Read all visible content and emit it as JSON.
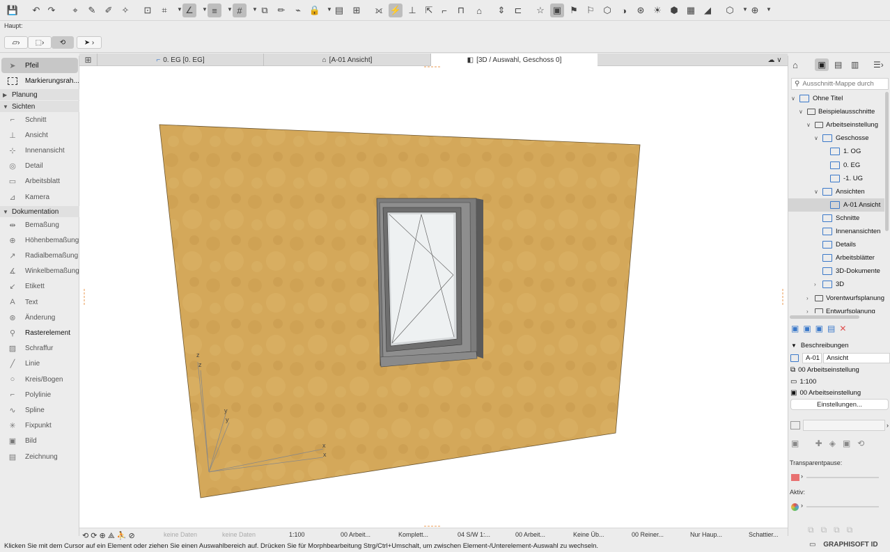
{
  "toolbar": {
    "icons": [
      "save-icon",
      "undo-icon",
      "redo-icon",
      "find-select-icon",
      "eyedropper-icon",
      "syringe-icon",
      "magic-wand-icon",
      "suspend-groups-icon",
      "gravity-icon",
      "snap-guides-icon",
      "guide-lines-icon",
      "grid-icon",
      "layers-icon",
      "pen-icon",
      "trace-icon",
      "lock-icon",
      "table-icon",
      "selection-grid-icon",
      "trim-icon",
      "split-icon",
      "adjust-icon",
      "offset-icon",
      "fillet-icon",
      "intersect-icon",
      "roof-icon",
      "elevate-icon",
      "resize-icon",
      "favorites-icon",
      "marquee-icon",
      "flag-icon",
      "flag2-icon",
      "shell-icon",
      "morph-icon",
      "object-icon",
      "lamp-icon",
      "zone-icon",
      "mesh-icon",
      "label-tag-icon",
      "view-3d-icon",
      "globe-icon"
    ]
  },
  "info": {
    "haupt_label": "Haupt:"
  },
  "toolbox": {
    "arrow": "Pfeil",
    "marquee": "Markierungsrah...",
    "group_planung": "Planung",
    "group_sichten": "Sichten",
    "sichten_tools": [
      "Schnitt",
      "Ansicht",
      "Innenansicht",
      "Detail",
      "Arbeitsblatt",
      "Kamera"
    ],
    "group_doku": "Dokumentation",
    "doku_tools": [
      "Bemaßung",
      "Höhenbemaßung",
      "Radialbemaßung",
      "Winkelbemaßung",
      "Etikett",
      "Text",
      "Änderung",
      "Rasterelement",
      "Schraffur",
      "Linie",
      "Kreis/Bogen",
      "Polylinie",
      "Spline",
      "Fixpunkt",
      "Bild",
      "Zeichnung"
    ]
  },
  "tabs": {
    "tab1": "0. EG [0. EG]",
    "tab2": "[A-01 Ansicht]",
    "tab3": "[3D / Auswahl, Geschoss 0]"
  },
  "viewport": {
    "axis_z": "z",
    "axis_y": "y",
    "axis_x": "x"
  },
  "statusbar": {
    "no_data_1": "keine Daten",
    "no_data_2": "keine Daten",
    "scale": "1:100",
    "layer": "00 Arbeit...",
    "model": "Komplett...",
    "pen": "04 S/W 1:...",
    "layer2": "00 Arbeit...",
    "overrides": "Keine Üb...",
    "renovation": "00 Reiner...",
    "structure": "Nur Haup...",
    "shading": "Schattier..."
  },
  "hint": "Klicken Sie mit dem Cursor auf ein Element oder ziehen Sie einen Auswahlbereich auf. Drücken Sie für Morphbearbeitung Strg/Ctrl+Umschalt, um zwischen Element-/Unterelement-Auswahl zu wechseln.",
  "navigator": {
    "search_placeholder": "Ausschnitt-Mappe durch",
    "tree": [
      {
        "label": "Ohne Titel",
        "depth": 0,
        "chev": "∨"
      },
      {
        "label": "Beispielausschnitte",
        "depth": 1,
        "chev": "∨"
      },
      {
        "label": "Arbeitseinstellung",
        "depth": 2,
        "chev": "∨"
      },
      {
        "label": "Geschosse",
        "depth": 3,
        "chev": "∨"
      },
      {
        "label": "1. OG",
        "depth": 4,
        "chev": ""
      },
      {
        "label": "0. EG",
        "depth": 4,
        "chev": ""
      },
      {
        "label": "-1. UG",
        "depth": 4,
        "chev": ""
      },
      {
        "label": "Ansichten",
        "depth": 3,
        "chev": "∨"
      },
      {
        "label": "A-01 Ansicht",
        "depth": 4,
        "chev": ""
      },
      {
        "label": "Schnitte",
        "depth": 3,
        "chev": ""
      },
      {
        "label": "Innenansichten",
        "depth": 3,
        "chev": ""
      },
      {
        "label": "Details",
        "depth": 3,
        "chev": ""
      },
      {
        "label": "Arbeitsblätter",
        "depth": 3,
        "chev": ""
      },
      {
        "label": "3D-Dokumente",
        "depth": 3,
        "chev": ""
      },
      {
        "label": "3D",
        "depth": 3,
        "chev": "›"
      },
      {
        "label": "Vorentwurfsplanung",
        "depth": 2,
        "chev": "›"
      },
      {
        "label": "Entwurfsplanung",
        "depth": 2,
        "chev": "›"
      }
    ],
    "props_header": "Beschreibungen",
    "id_value": "A-01",
    "name_value": "Ansicht",
    "layer_combo": "00 Arbeitseinstellung",
    "scale": "1:100",
    "model_view": "00 Arbeitseinstellung",
    "settings_button": "Einstellungen...",
    "transparent_label": "Transparentpause:",
    "active_label": "Aktiv:",
    "brand": "GRAPHISOFT ID"
  },
  "colors": {
    "wall": "#d4a85a",
    "accent": "#3a78c9",
    "delete": "#e05050"
  }
}
